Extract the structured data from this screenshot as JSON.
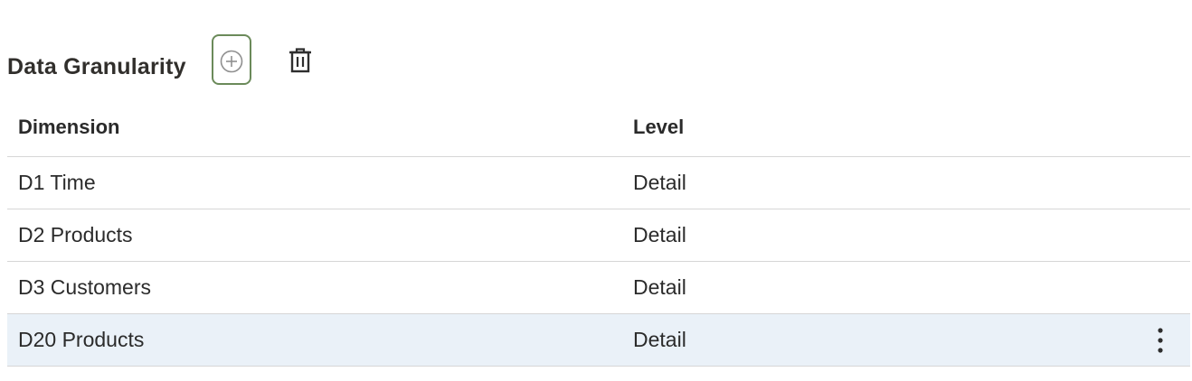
{
  "section": {
    "title": "Data Granularity"
  },
  "toolbar": {
    "add_icon": "plus-circle-icon",
    "delete_icon": "trash-icon"
  },
  "table": {
    "columns": [
      "Dimension",
      "Level"
    ],
    "rows": [
      {
        "dimension": "D1 Time",
        "level": "Detail"
      },
      {
        "dimension": "D2 Products",
        "level": "Detail"
      },
      {
        "dimension": "D3 Customers",
        "level": "Detail"
      },
      {
        "dimension": "D20 Products",
        "level": "Detail",
        "selected": true
      }
    ]
  },
  "colors": {
    "selected_row_bg": "#eaf1f8",
    "add_button_border": "#6b8a5a",
    "divider": "#d6d6d6"
  }
}
